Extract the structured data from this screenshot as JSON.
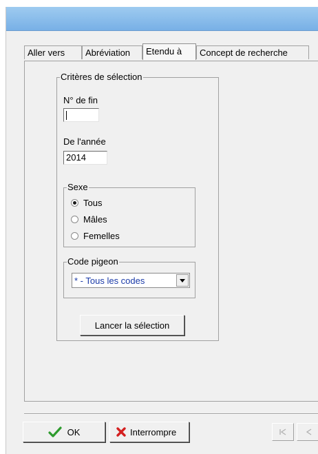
{
  "tabs": [
    {
      "label": "Aller vers",
      "active": false
    },
    {
      "label": "Abréviation",
      "active": false
    },
    {
      "label": "Etendu à",
      "active": true
    },
    {
      "label": "Concept de recherche",
      "active": false
    }
  ],
  "criteria": {
    "legend": "Critères de sélection",
    "end_number_label": "N° de fin",
    "end_number_value": "",
    "year_label": "De l'année",
    "year_value": "2014"
  },
  "sex": {
    "legend": "Sexe",
    "options": [
      {
        "label": "Tous",
        "checked": true
      },
      {
        "label": "Mâles",
        "checked": false
      },
      {
        "label": "Femelles",
        "checked": false
      }
    ]
  },
  "pigeon_code": {
    "legend": "Code pigeon",
    "selected": "* - Tous les codes"
  },
  "run_selection_label": "Lancer la sélection",
  "footer": {
    "ok_label": "OK",
    "abort_label": "Interrompre"
  },
  "colors": {
    "check_green": "#2e9b2e",
    "cross_red": "#d42020",
    "combo_text": "#1a3aa8"
  },
  "icons": {
    "ok": "checkmark-icon",
    "abort": "cross-icon",
    "nav_first": "first-record-icon",
    "nav_prev": "previous-record-icon"
  }
}
